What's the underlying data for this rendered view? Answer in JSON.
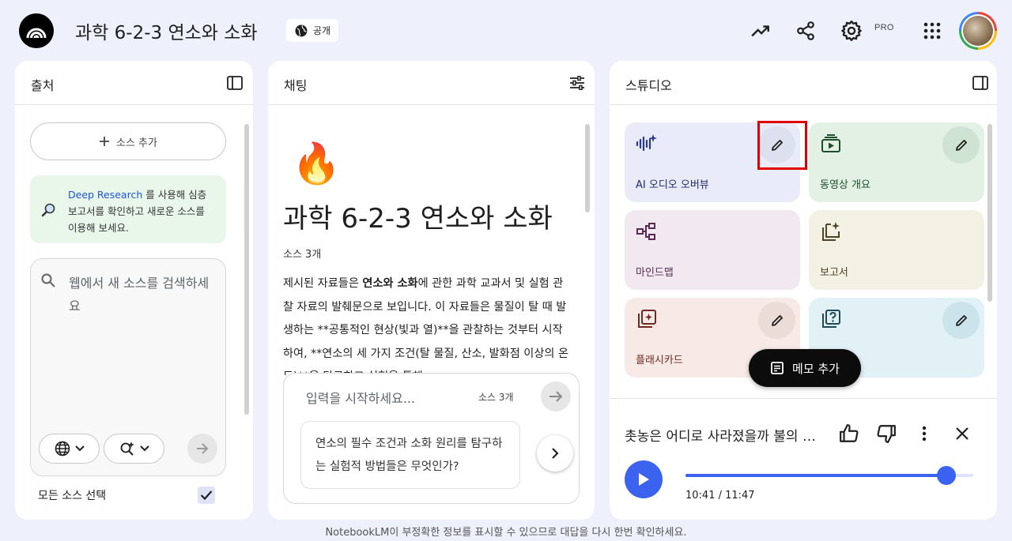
{
  "header": {
    "notebook_title": "과학 6-2-3 연소와 소화",
    "visibility_label": "공개",
    "pro_label": "PRO",
    "icons": [
      "analytics-icon",
      "share-icon",
      "settings-icon",
      "apps-grid-icon"
    ]
  },
  "sources": {
    "title": "출처",
    "add_source_label": "소스 추가",
    "deep_research": {
      "link_text": "Deep Research",
      "text": " 를 사용해 심층 보고서를 확인하고 새로운 소스를 이용해 보세요."
    },
    "web_search_placeholder": "웹에서 새 소스를 검색하세요",
    "select_all_label": "모든 소스 선택",
    "select_all_checked": true
  },
  "chat": {
    "title": "채팅",
    "emoji": "🔥",
    "notebook_title": "과학 6-2-3 연소와 소화",
    "source_count": "소스 3개",
    "summary": {
      "part1": "제시된 자료들은 ",
      "bold": "연소와 소화",
      "part2": "에 관한 과학 교과서 및 실험 관찰 자료의 발췌문으로 보입니다. 이 자료들은 물질이 탈 때 발생하는 **공통적인 현상(빛과 열)**을 관찰하는 것부터 시작하여, **연소의 세 가지 조건(탈 물질, 산소, 발화점 이상의 온도)**을 탐구하고 실험을 통해"
    },
    "input_placeholder": "입력을 시작하세요...",
    "input_source_count": "소스 3개",
    "suggestion": "연소의 필수 조건과 소화 원리를 탐구하는 실험적 방법들은 무엇인가?"
  },
  "studio": {
    "title": "스튜디오",
    "tiles": [
      {
        "label": "AI 오디오 오버뷰",
        "icon": "audio-waveform-icon",
        "bg": "#e9ecf8",
        "fg": "#1f2d6e"
      },
      {
        "label": "동영상 개요",
        "icon": "video-overview-icon",
        "bg": "#e2f1e4",
        "fg": "#1e4d2b"
      },
      {
        "label": "마인드맵",
        "icon": "mind-map-icon",
        "bg": "#f1e8f0",
        "fg": "#5a2a56"
      },
      {
        "label": "보고서",
        "icon": "report-icon",
        "bg": "#f3f0e4",
        "fg": "#4d4322"
      },
      {
        "label": "플래시카드",
        "icon": "flashcard-icon",
        "bg": "#f6e9e6",
        "fg": "#6e2a20"
      },
      {
        "label": "",
        "icon": "quiz-icon",
        "bg": "#e1f1f6",
        "fg": "#1b4a5a"
      }
    ],
    "memo_button_label": "메모 추가",
    "player": {
      "title": "촛농은 어디로 사라졌을까 불의 비밀",
      "elapsed": "10:41",
      "total": "11:47",
      "time_text": "10:41 / 11:47",
      "progress": 0.907
    }
  },
  "footer": {
    "disclaimer": "NotebookLM이 부정확한 정보를 표시할 수 있으므로 대답을 다시 한번 확인하세요."
  },
  "colors": {
    "background": "#eef0fb",
    "accent": "#3b63f0",
    "highlight": "#e00000"
  }
}
